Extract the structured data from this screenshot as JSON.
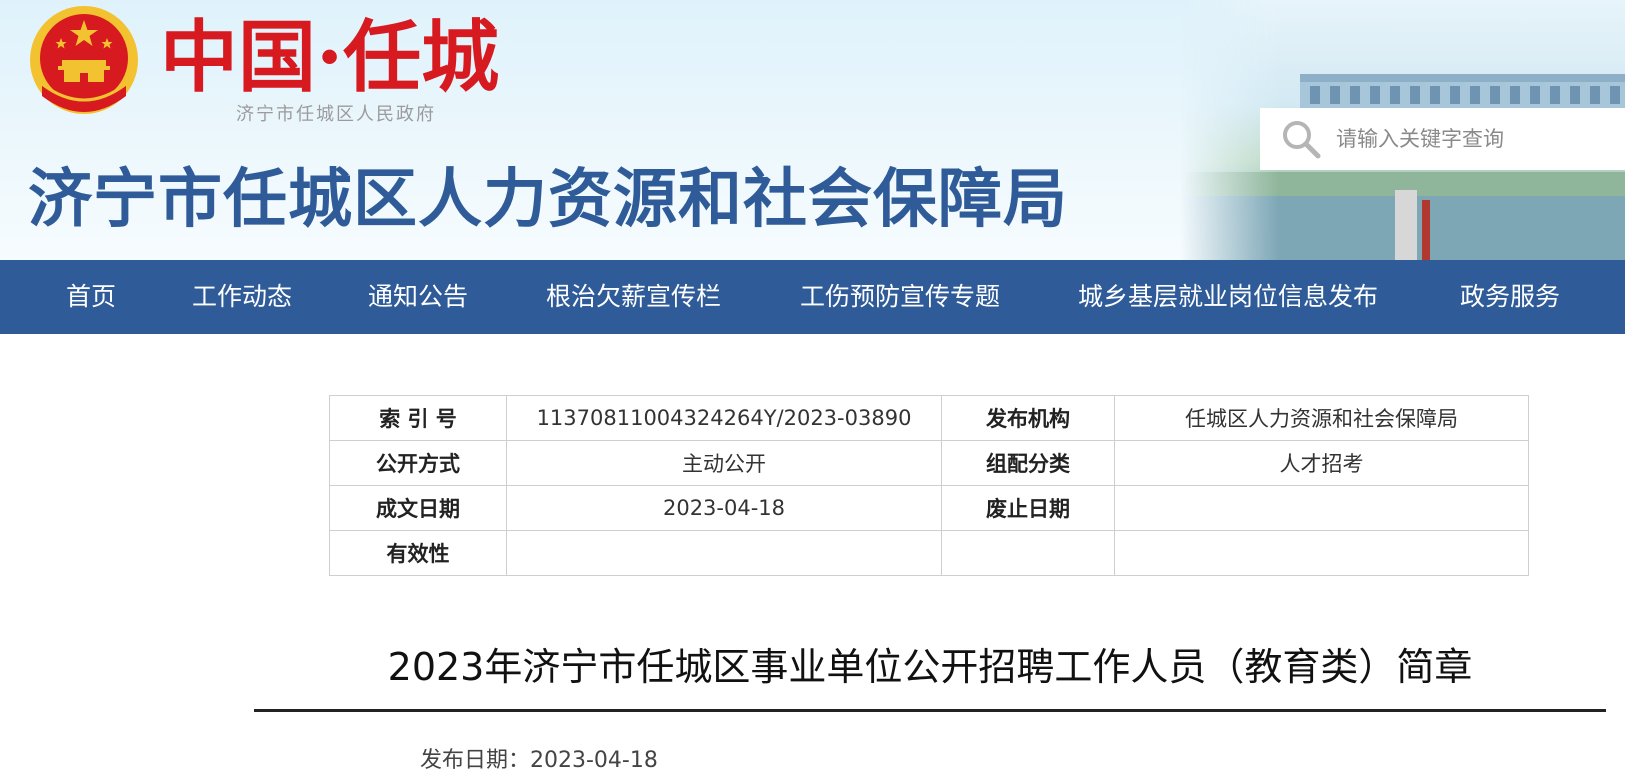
{
  "header": {
    "brand_main": "中国·任城",
    "brand_sub": "济宁市任城区人民政府",
    "site_title": "济宁市任城区人力资源和社会保障局",
    "search_placeholder": "请输入关键字查询"
  },
  "nav": {
    "items": [
      "首页",
      "工作动态",
      "通知公告",
      "根治欠薪宣传栏",
      "工伤预防宣传专题",
      "城乡基层就业岗位信息发布",
      "政务服务"
    ]
  },
  "meta": {
    "rows": [
      {
        "l1": "索 引 号",
        "v1": "11370811004324264Y/2023-03890",
        "l2": "发布机构",
        "v2": "任城区人力资源和社会保障局"
      },
      {
        "l1": "公开方式",
        "v1": "主动公开",
        "l2": "组配分类",
        "v2": "人才招考"
      },
      {
        "l1": "成文日期",
        "v1": "2023-04-18",
        "l2": "废止日期",
        "v2": ""
      },
      {
        "l1": "有效性",
        "v1": "",
        "l2": "",
        "v2": ""
      }
    ]
  },
  "article": {
    "title": "2023年济宁市任城区事业单位公开招聘工作人员（教育类）简章",
    "pub_date": "发布日期：2023-04-18"
  },
  "colors": {
    "brand_blue": "#2f5c99",
    "brand_red": "#d71920",
    "emblem_gold": "#f2c230"
  }
}
